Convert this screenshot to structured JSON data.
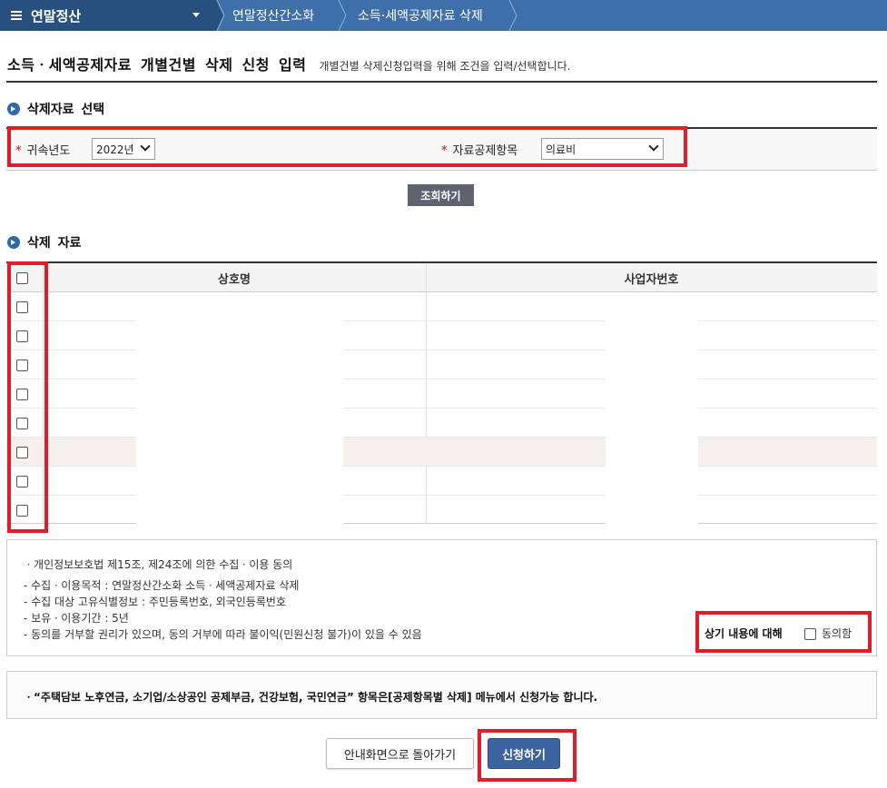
{
  "topbar": {
    "menu_label": "연말정산",
    "crumbs": [
      "연말정산간소화",
      "소득·세액공제자료 삭제"
    ]
  },
  "header": {
    "title": "소득ㆍ세액공제자료 개별건별 삭제 신청 입력",
    "description": "개별건별 삭제신청입력을 위해 조건을 입력/선택합니다."
  },
  "search": {
    "section_title": "삭제자료 선택",
    "year_label": "귀속년도",
    "year_value": "2022년",
    "item_label": "자료공제항목",
    "item_value": "의료비",
    "required_mark": "*",
    "search_button": "조회하기"
  },
  "results": {
    "section_title": "삭제 자료",
    "columns": [
      "상호명",
      "사업자번호"
    ],
    "row_count": 8
  },
  "consent": {
    "lines": [
      "ㆍ개인정보보호법 제15조, 제24조에 의한 수집ㆍ이용 동의",
      "- 수집ㆍ이용목적 : 연말정산간소화 소득ㆍ세액공제자료 삭제",
      "- 수집 대상 고유식별정보 : 주민등록번호, 외국인등록번호",
      "- 보유ㆍ이용기간 : 5년",
      "- 동의를 거부할 권리가 있으며, 동의 거부에 따라 불이익(민원신청 불가)이 있을 수 있음"
    ],
    "agree_prompt": "상기 내용에 대해",
    "agree_label": "동의함"
  },
  "notice": {
    "text": "ㆍ“주택담보 노후연금, 소기업/소상공인 공제부금, 건강보험, 국민연금” 항목은[공제항목별 삭제] 메뉴에서 신청가능 합니다."
  },
  "actions": {
    "back_button": "안내화면으로 돌아가기",
    "submit_button": "신청하기"
  },
  "colors": {
    "nav_bar": "#3f6fa9",
    "nav_menu": "#27507f",
    "highlight": "#e01e2a",
    "submit": "#3a63a0"
  }
}
